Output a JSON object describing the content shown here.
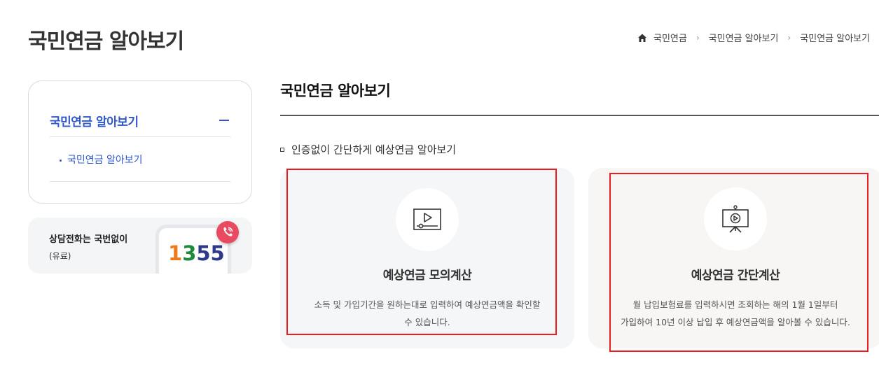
{
  "page": {
    "title": "국민연금 알아보기"
  },
  "breadcrumb": {
    "items": [
      "국민연금",
      "국민연금 알아보기",
      "국민연금 알아보기"
    ],
    "separator": "›"
  },
  "sidebar": {
    "title": "국민연금 알아보기",
    "items": [
      {
        "label": "국민연금 알아보기"
      }
    ]
  },
  "call": {
    "title": "상담전화는 국번없이",
    "subtitle": "(유료)",
    "number_parts": [
      "1",
      "3",
      "55"
    ]
  },
  "main": {
    "title": "국민연금 알아보기",
    "section_label": "인증없이 간단하게 예상연금 알아보기",
    "cards": [
      {
        "icon": "video-player-icon",
        "title": "예상연금 모의계산",
        "desc_lines": [
          "소득 및 가입기간을 원하는대로 입력하여 예상연금액을 확인할",
          "수 있습니다."
        ]
      },
      {
        "icon": "presentation-board-icon",
        "title": "예상연금 간단계산",
        "desc_lines": [
          "월 납입보험료를 입력하시면 조회하는 해의 1월 1일부터",
          "가입하여 10년 이상 납입 후 예상연금액을 알아볼 수 있습니다."
        ]
      }
    ]
  },
  "colors": {
    "accent": "#2f59c8",
    "highlight": "#ee1c1c",
    "call_badge": "#e84a5f",
    "num_orange": "#f07b1d",
    "num_green": "#1e8a3c",
    "num_navy": "#2d3a8c"
  }
}
